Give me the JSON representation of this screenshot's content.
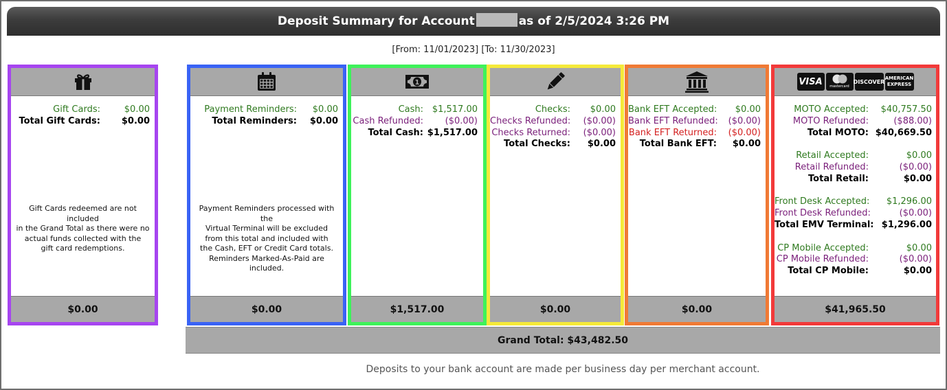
{
  "header": {
    "title_prefix": "Deposit Summary for Account",
    "title_suffix": "as of 2/5/2024 3:26 PM",
    "date_range": "[From: 11/01/2023] [To: 11/30/2023]"
  },
  "colors": {
    "gift": "#a645f0",
    "reminders": "#3a63f5",
    "cash": "#3ef25a",
    "checks": "#f5ea3a",
    "bank": "#f07a35",
    "cards": "#f23a3a",
    "accepted": "#2f7a1f",
    "refunded": "#7a1f7a",
    "returned": "#d42020"
  },
  "gift": {
    "icon": "gift-icon",
    "rows": [
      {
        "label": "Gift Cards:",
        "value": "$0.00"
      },
      {
        "label": "Total Gift Cards:",
        "value": "$0.00"
      }
    ],
    "note": [
      "Gift Cards redeemed are not included",
      "in the Grand Total as there were no",
      "actual funds collected with the",
      "gift card redemptions."
    ],
    "total": "$0.00"
  },
  "reminders": {
    "icon": "calendar-icon",
    "rows": [
      {
        "label": "Payment Reminders:",
        "value": "$0.00"
      },
      {
        "label": "Total Reminders:",
        "value": "$0.00"
      }
    ],
    "note": [
      "Payment Reminders processed with the",
      "Virtual Terminal will be excluded",
      "from this total and included with",
      "the Cash, EFT or Credit Card totals.",
      "Reminders Marked-As-Paid are included."
    ],
    "total": "$0.00"
  },
  "cash": {
    "icon": "money-bill-icon",
    "rows": [
      {
        "label": "Cash:",
        "value": "$1,517.00"
      },
      {
        "label": "Cash Refunded:",
        "value": "($0.00)"
      },
      {
        "label": "Total Cash:",
        "value": "$1,517.00"
      }
    ],
    "total": "$1,517.00"
  },
  "checks": {
    "icon": "pencil-icon",
    "rows": [
      {
        "label": "Checks:",
        "value": "$0.00"
      },
      {
        "label": "Checks Refunded:",
        "value": "($0.00)"
      },
      {
        "label": "Checks Returned:",
        "value": "($0.00)"
      },
      {
        "label": "Total Checks:",
        "value": "$0.00"
      }
    ],
    "total": "$0.00"
  },
  "bank": {
    "icon": "bank-icon",
    "rows": [
      {
        "label": "Bank EFT Accepted:",
        "value": "$0.00"
      },
      {
        "label": "Bank EFT Refunded:",
        "value": "($0.00)"
      },
      {
        "label": "Bank EFT Returned:",
        "value": "($0.00)"
      },
      {
        "label": "Total Bank EFT:",
        "value": "$0.00"
      }
    ],
    "total": "$0.00"
  },
  "cards": {
    "logos": {
      "visa": "VISA",
      "mastercard": "mastercard",
      "discover": "DISCOVER",
      "amex_line1": "AMERICAN",
      "amex_line2": "EXPRESS"
    },
    "rows": [
      {
        "label": "MOTO Accepted:",
        "value": "$40,757.50"
      },
      {
        "label": "MOTO Refunded:",
        "value": "($88.00)"
      },
      {
        "label": "Total MOTO:",
        "value": "$40,669.50"
      },
      {
        "label": "Retail Accepted:",
        "value": "$0.00"
      },
      {
        "label": "Retail Refunded:",
        "value": "($0.00)"
      },
      {
        "label": "Total Retail:",
        "value": "$0.00"
      },
      {
        "label": "Front Desk Accepted:",
        "value": "$1,296.00"
      },
      {
        "label": "Front Desk Refunded:",
        "value": "($0.00)"
      },
      {
        "label": "Total EMV Terminal:",
        "value": "$1,296.00"
      },
      {
        "label": "CP Mobile Accepted:",
        "value": "$0.00"
      },
      {
        "label": "CP Mobile Refunded:",
        "value": "($0.00)"
      },
      {
        "label": "Total CP Mobile:",
        "value": "$0.00"
      }
    ],
    "total": "$41,965.50"
  },
  "grand_total": "Grand Total: $43,482.50",
  "footnote": "Deposits to your bank account are made per business day per merchant account."
}
